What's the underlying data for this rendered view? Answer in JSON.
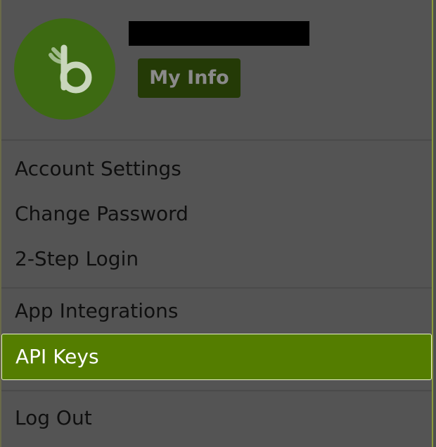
{
  "profile": {
    "avatar_icon": "bamboohr-b-logo-icon",
    "name": "",
    "my_info_label": "My Info"
  },
  "menu": {
    "account_settings": "Account Settings",
    "change_password": "Change Password",
    "two_step_login": "2-Step Login",
    "app_integrations": "App Integrations",
    "api_keys": "API Keys",
    "log_out": "Log Out"
  },
  "colors": {
    "background": "#545454",
    "avatar": "#3d6a12",
    "my_info_button": "#243a06",
    "active_item": "#547d00",
    "active_text": "#ffffff",
    "text": "#0f0f0f"
  }
}
